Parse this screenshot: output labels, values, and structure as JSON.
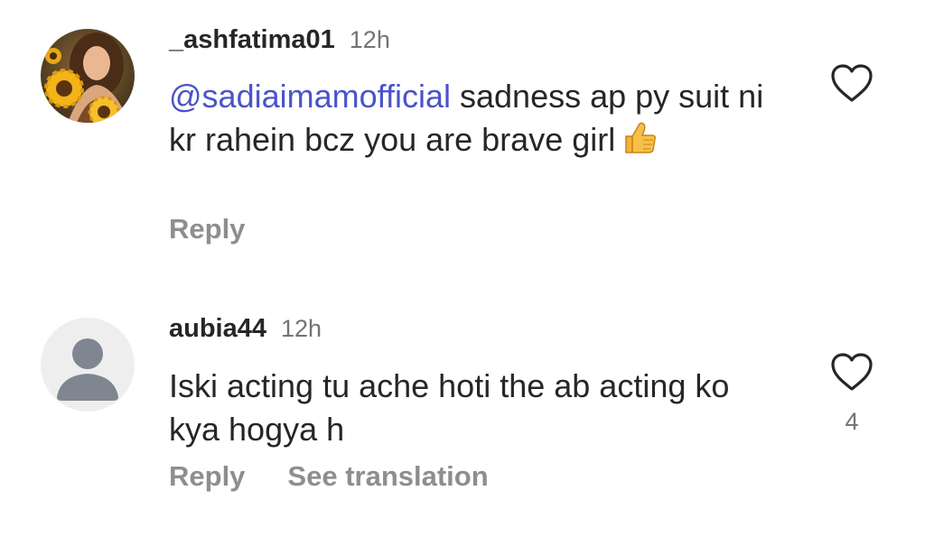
{
  "comments": [
    {
      "username": "_ashfatima01",
      "time": "12h",
      "mention": "@sadiaimamofficial",
      "text": " sadness ap py suit ni kr rahein bcz you are brave girl",
      "emoji": "thumbs-up",
      "actions": [
        "Reply"
      ],
      "likes": "",
      "avatar": "sunflower-portrait"
    },
    {
      "username": "aubia44",
      "time": "12h",
      "mention": "",
      "text": "Iski acting tu ache hoti the ab acting ko kya hogya h",
      "actions": [
        "Reply",
        "See translation"
      ],
      "likes": "4",
      "avatar": "default-profile"
    }
  ],
  "colors": {
    "mention": "#4a54c9",
    "secondary_text": "#8e8e8e",
    "primary_text": "#262626"
  }
}
